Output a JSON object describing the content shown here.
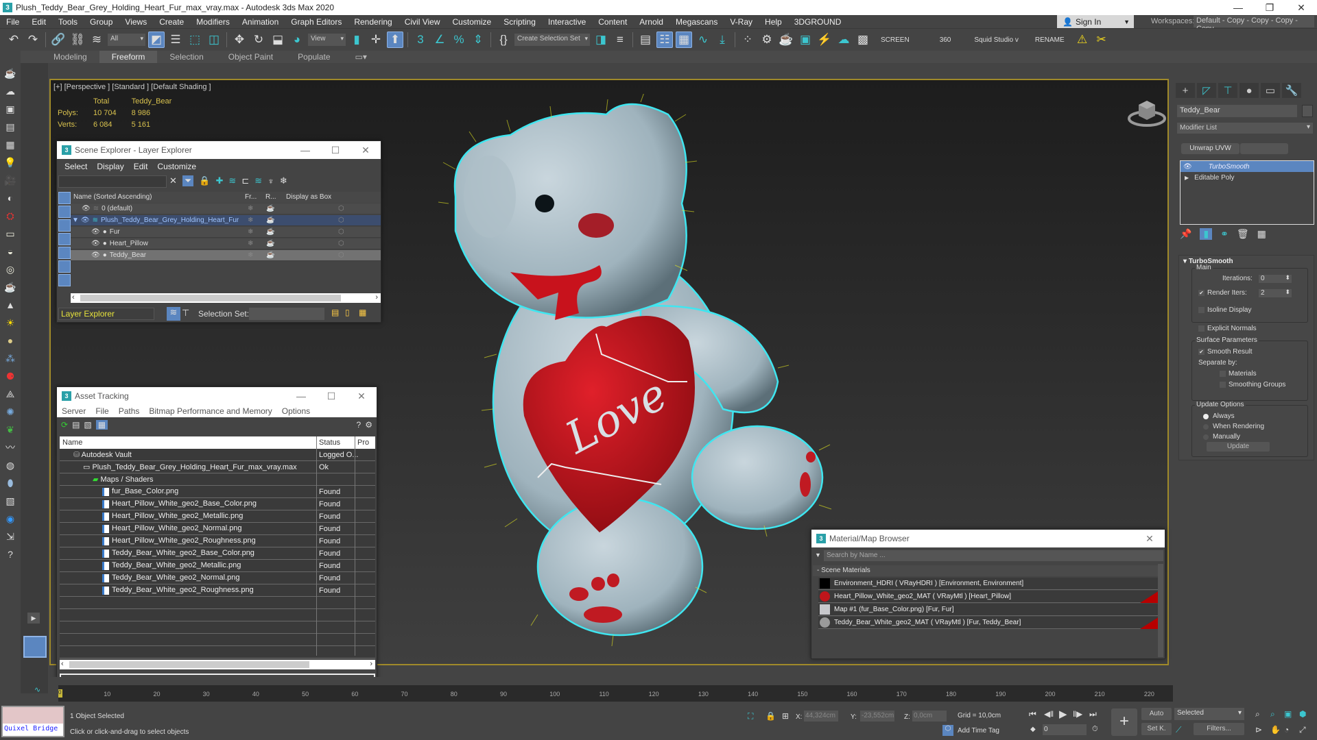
{
  "window": {
    "title": "Plush_Teddy_Bear_Grey_Holding_Heart_Fur_max_vray.max - Autodesk 3ds Max 2020",
    "app_icon": "3",
    "controls": [
      "—",
      "❐",
      "✕"
    ]
  },
  "menubar": {
    "items": [
      "File",
      "Edit",
      "Tools",
      "Group",
      "Views",
      "Create",
      "Modifiers",
      "Animation",
      "Graph Editors",
      "Rendering",
      "Civil View",
      "Customize",
      "Scripting",
      "Interactive",
      "Content",
      "Arnold",
      "Megascans",
      "V-Ray",
      "Help",
      "3DGROUND"
    ],
    "sign_in": "Sign In",
    "workspaces_label": "Workspaces:",
    "workspace_value": "Default - Copy - Copy - Copy - Copy"
  },
  "toolbar": {
    "filter_value": "All",
    "view_value": "View",
    "selection_set_placeholder": "Create Selection Set",
    "text_buttons": [
      "SCREEN",
      "360",
      "Squid Studio v",
      "RENAME"
    ]
  },
  "ribbon": {
    "tabs": [
      "Modeling",
      "Freeform",
      "Selection",
      "Object Paint",
      "Populate"
    ],
    "active_tab": "Freeform"
  },
  "viewport": {
    "label": "[+] [Perspective ] [Standard ] [Default Shading ]",
    "stats": {
      "col_total": "Total",
      "col_object": "Teddy_Bear",
      "polys_label": "Polys:",
      "polys_total": "10 704",
      "polys_object": "8 986",
      "verts_label": "Verts:",
      "verts_total": "6 084",
      "verts_object": "5 161"
    },
    "heart_text": "Love"
  },
  "scene_explorer": {
    "title": "Scene Explorer - Layer Explorer",
    "menu": [
      "Select",
      "Display",
      "Edit",
      "Customize"
    ],
    "columns": [
      "Name (Sorted Ascending)",
      "Fr...",
      "R...",
      "Display as Box"
    ],
    "rows": [
      {
        "name": "0 (default)",
        "level": 0
      },
      {
        "name": "Plush_Teddy_Bear_Grey_Holding_Heart_Fur",
        "level": 0
      },
      {
        "name": "Fur",
        "level": 1
      },
      {
        "name": "Heart_Pillow",
        "level": 1
      },
      {
        "name": "Teddy_Bear",
        "level": 1
      }
    ],
    "mode": "Layer Explorer",
    "selection_set_label": "Selection Set:"
  },
  "asset_tracking": {
    "title": "Asset Tracking",
    "menu": [
      "Server",
      "File",
      "Paths",
      "Bitmap Performance and Memory",
      "Options"
    ],
    "columns": [
      "Name",
      "Status",
      "Pro"
    ],
    "rows": [
      {
        "name": "Autodesk Vault",
        "status": "Logged O..."
      },
      {
        "name": "Plush_Teddy_Bear_Grey_Holding_Heart_Fur_max_vray.max",
        "status": "Ok"
      },
      {
        "name": "Maps / Shaders",
        "status": ""
      },
      {
        "name": "fur_Base_Color.png",
        "status": "Found"
      },
      {
        "name": "Heart_Pillow_White_geo2_Base_Color.png",
        "status": "Found"
      },
      {
        "name": "Heart_Pillow_White_geo2_Metallic.png",
        "status": "Found"
      },
      {
        "name": "Heart_Pillow_White_geo2_Normal.png",
        "status": "Found"
      },
      {
        "name": "Heart_Pillow_White_geo2_Roughness.png",
        "status": "Found"
      },
      {
        "name": "Teddy_Bear_White_geo2_Base_Color.png",
        "status": "Found"
      },
      {
        "name": "Teddy_Bear_White_geo2_Metallic.png",
        "status": "Found"
      },
      {
        "name": "Teddy_Bear_White_geo2_Normal.png",
        "status": "Found"
      },
      {
        "name": "Teddy_Bear_White_geo2_Roughness.png",
        "status": "Found"
      }
    ]
  },
  "command_panel": {
    "object_name": "Teddy_Bear",
    "modifier_list": "Modifier List",
    "unwrap_button": "Unwrap UVW",
    "stack": [
      "TurboSmooth",
      "Editable Poly"
    ],
    "turbosmooth": {
      "title": "TurboSmooth",
      "main_label": "Main",
      "iterations_label": "Iterations:",
      "iterations": "0",
      "render_iters_label": "Render Iters:",
      "render_iters": "2",
      "render_iters_checked": true,
      "isoline_label": "Isoline Display",
      "explicit_normals_label": "Explicit Normals",
      "surface_label": "Surface Parameters",
      "smooth_result_label": "Smooth Result",
      "separate_by_label": "Separate by:",
      "materials_label": "Materials",
      "smoothing_groups_label": "Smoothing Groups",
      "update_options_label": "Update Options",
      "always_label": "Always",
      "when_rendering_label": "When Rendering",
      "manually_label": "Manually",
      "update_button": "Update"
    }
  },
  "material_browser": {
    "title": "Material/Map Browser",
    "search_placeholder": "Search by Name ...",
    "section": "- Scene Materials",
    "rows": [
      {
        "name": "Environment_HDRI  ( VRayHDRI )  [Environment, Environment]",
        "swatch": "#000000",
        "flag": false
      },
      {
        "name": "Heart_Pillow_White_geo2_MAT  ( VRayMtl )  [Heart_Pillow]",
        "swatch": "#c0151b",
        "flag": true
      },
      {
        "name": "Map #1 (fur_Base_Color.png)  [Fur, Fur]",
        "swatch": "#c8c8cc",
        "flag": false
      },
      {
        "name": "Teddy_Bear_White_geo2_MAT  ( VRayMtl )  [Fur, Teddy_Bear]",
        "swatch": "#9a9a9a",
        "flag": true
      }
    ]
  },
  "timeline": {
    "current_frame": "0",
    "ticks": [
      "10",
      "20",
      "30",
      "40",
      "50",
      "60",
      "70",
      "80",
      "90",
      "100",
      "110",
      "120",
      "130",
      "140",
      "150",
      "160",
      "170",
      "180",
      "190",
      "200",
      "210",
      "220"
    ]
  },
  "statusbar": {
    "quixel": "Quixel Bridge",
    "status_line1": "1 Object Selected",
    "status_line2": "Click or click-and-drag to select objects",
    "x_label": "X:",
    "x_value": "44,324cm",
    "y_label": "Y:",
    "y_value": "-23,552cm",
    "z_label": "Z:",
    "z_value": "0,0cm",
    "grid": "Grid = 10,0cm",
    "add_time_tag": "Add Time Tag",
    "frame_value": "0",
    "auto": "Auto",
    "set_key": "Set K.",
    "key_filter": "Selected",
    "filters": "Filters..."
  }
}
